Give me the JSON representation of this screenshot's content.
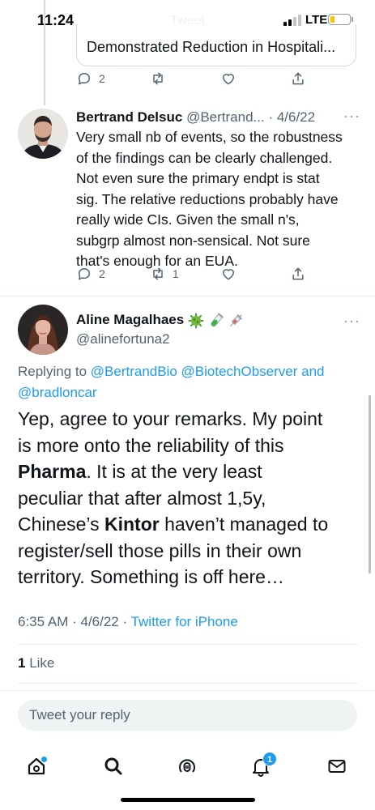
{
  "status_bar": {
    "time": "11:24",
    "header_ghost": "Tweet",
    "network": "LTE",
    "battery_level": 0.2,
    "battery_color": "#f5c400"
  },
  "quoted_tweet": {
    "text": "Demonstrated Reduction in Hospitali...",
    "actions": {
      "reply_count": "2",
      "retweet_count": "",
      "like_count": ""
    }
  },
  "reply_tweet": {
    "author_name": "Bertrand Delsuc",
    "author_handle": "@Bertrand...",
    "date": "· 4/6/22",
    "more": "···",
    "body_lines": [
      "Very small nb of events, so the robustness",
      "of the findings can be clearly challenged.",
      "Not even sure the primary endpt is stat",
      "sig. The relative reductions probably have",
      "really wide CIs. Given the small n's,",
      "subgrp almost non-sensical. Not sure",
      "that's enough for an EUA."
    ],
    "actions": {
      "reply_count": "2",
      "retweet_count": "1",
      "like_count": ""
    }
  },
  "main_tweet": {
    "author_name": "Aline Magalhaes",
    "author_handle": "@alinefortuna2",
    "name_emojis": [
      "virus-emoji",
      "test-tube-emoji",
      "syringe-emoji"
    ],
    "more": "···",
    "replying_prefix": "Replying to ",
    "replying_mentions": [
      "@BertrandBio",
      "@BiotechObserver"
    ],
    "replying_and": " and",
    "replying_last": "@bradloncar",
    "body": {
      "l1": "Yep, agree to your remarks. My point",
      "l2": "is more onto the reliability of this",
      "l3_bold": "Pharma",
      "l3_rest": ". It is at the very least",
      "l4": "peculiar that after almost 1,5y,",
      "l5_pre": "Chinese’s ",
      "l5_bold": "Kintor",
      "l5_rest": " haven’t managed to",
      "l6": "register/sell those pills in their own",
      "l7": "territory. Something is off here…"
    },
    "time": "6:35 AM",
    "date": "4/6/22",
    "separator": " · ",
    "source": "Twitter for iPhone",
    "likes_count": "1",
    "likes_label": " Like"
  },
  "composer": {
    "placeholder": "Tweet your reply"
  },
  "tab_bar": {
    "tabs": [
      "home-icon",
      "search-icon",
      "spaces-icon",
      "notifications-icon",
      "messages-icon"
    ],
    "notification_count": "1"
  },
  "colors": {
    "accent": "#1d9bf0",
    "secondary_text": "#536471",
    "primary_text": "#0f1419",
    "border": "#cfd9de"
  }
}
